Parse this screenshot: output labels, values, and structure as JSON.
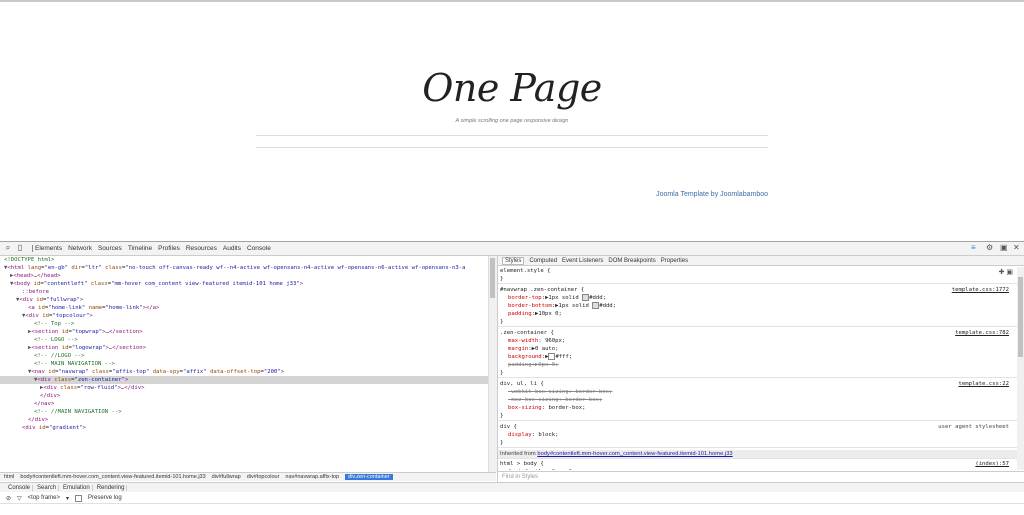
{
  "page": {
    "logo": "One Page",
    "tagline": "A simple scrolling one page responsive design",
    "footer_link": "Joomla Template by Joomlabamboo"
  },
  "devtools": {
    "tabs": [
      "Elements",
      "Network",
      "Sources",
      "Timeline",
      "Profiles",
      "Resources",
      "Audits",
      "Console"
    ],
    "dom_lines": [
      {
        "indent": 0,
        "html": "<span class='cmt'>&lt;!DOCTYPE html&gt;</span>"
      },
      {
        "indent": 0,
        "html": "<span class='tri'>▼</span><span class='tag'>&lt;html</span> <span class='attr'>lang</span>=<span class='val'>\"en-gb\"</span> <span class='attr'>dir</span>=<span class='val'>\"ltr\"</span> <span class='attr'>class</span>=<span class='val'>\"no-touch off-canvas-ready wf--n4-active wf-opensans-n4-active wf-opensans-n6-active wf-opensans-n3-a</span>"
      },
      {
        "indent": 1,
        "html": "<span class='tri'>▶</span><span class='tag'>&lt;head&gt;</span>…<span class='tag'>&lt;/head&gt;</span>"
      },
      {
        "indent": 1,
        "html": "<span class='tri'>▼</span><span class='tag'>&lt;body</span> <span class='attr'>id</span>=<span class='val'>\"contentleft\"</span> <span class='attr'>class</span>=<span class='val'>\"mm-hover com_content view-featured itemid-101 home j33\"</span><span class='tag'>&gt;</span>"
      },
      {
        "indent": 3,
        "html": "<span class='pseudo'>::before</span>"
      },
      {
        "indent": 2,
        "html": "<span class='tri'>▼</span><span class='tag'>&lt;div</span> <span class='attr'>id</span>=<span class='val'>\"fullwrap\"</span><span class='tag'>&gt;</span>"
      },
      {
        "indent": 4,
        "html": "<span class='tag'>&lt;a</span> <span class='attr'>id</span>=<span class='val'>\"home-link\"</span> <span class='attr'>name</span>=<span class='val'>\"home-link\"</span><span class='tag'>&gt;&lt;/a&gt;</span>"
      },
      {
        "indent": 3,
        "html": "<span class='tri'>▼</span><span class='tag'>&lt;div</span> <span class='attr'>id</span>=<span class='val'>\"topcolour\"</span><span class='tag'>&gt;</span>"
      },
      {
        "indent": 5,
        "html": "<span class='cmt'>&lt;!-- Top --&gt;</span>"
      },
      {
        "indent": 4,
        "html": "<span class='tri'>▶</span><span class='tag'>&lt;section</span> <span class='attr'>id</span>=<span class='val'>\"topwrap\"</span><span class='tag'>&gt;</span>…<span class='tag'>&lt;/section&gt;</span>"
      },
      {
        "indent": 5,
        "html": "<span class='cmt'>&lt;!-- LOGO --&gt;</span>"
      },
      {
        "indent": 4,
        "html": "<span class='tri'>▶</span><span class='tag'>&lt;section</span> <span class='attr'>id</span>=<span class='val'>\"logowrap\"</span><span class='tag'>&gt;</span>…<span class='tag'>&lt;/section&gt;</span>"
      },
      {
        "indent": 5,
        "html": "<span class='cmt'>&lt;!-- //LOGO --&gt;</span>"
      },
      {
        "indent": 5,
        "html": "<span class='cmt'>&lt;!-- MAIN NAVIGATION --&gt;</span>"
      },
      {
        "indent": 4,
        "html": "<span class='tri'>▼</span><span class='tag'>&lt;nav</span> <span class='attr'>id</span>=<span class='val'>\"navwrap\"</span> <span class='attr'>class</span>=<span class='val'>\"affix-top\"</span> <span class='attr'>data-spy</span>=<span class='val'>\"affix\"</span> <span class='attr'>data-offset-top</span>=<span class='val'>\"200\"</span><span class='tag'>&gt;</span>"
      },
      {
        "indent": 5,
        "sel": true,
        "html": "<span class='tri'>▼</span><span class='tag'>&lt;div</span> <span class='attr'>class</span>=<span class='val'>\"zen-container\"</span><span class='tag'>&gt;</span>"
      },
      {
        "indent": 6,
        "html": "<span class='tri'>▶</span><span class='tag'>&lt;div</span> <span class='attr'>class</span>=<span class='val'>\"row-fluid\"</span><span class='tag'>&gt;</span>…<span class='tag'>&lt;/div&gt;</span>"
      },
      {
        "indent": 6,
        "html": "<span class='tag'>&lt;/div&gt;</span>"
      },
      {
        "indent": 5,
        "html": "<span class='tag'>&lt;/nav&gt;</span>"
      },
      {
        "indent": 5,
        "html": "<span class='cmt'>&lt;!-- //MAIN NAVIGATION --&gt;</span>"
      },
      {
        "indent": 4,
        "html": "<span class='tag'>&lt;/div&gt;</span>"
      },
      {
        "indent": 3,
        "html": "<span class='tag'>&lt;div</span> <span class='attr'>id</span>=<span class='val'>\"gradient\"</span><span class='tag'>&gt;</span>"
      }
    ],
    "breadcrumbs": [
      "html",
      "body#contentleft.mm-hover.com_content.view-featured.itemid-101.home.j33",
      "div#fullwrap",
      "div#topcolour",
      "nav#navwrap.affix-top",
      "div.zen-container"
    ],
    "side_tabs": [
      "Styles",
      "Computed",
      "Event Listeners",
      "DOM Breakpoints",
      "Properties"
    ],
    "rules": [
      {
        "selector": "element.style {",
        "src": "",
        "lines": [
          "}"
        ]
      },
      {
        "selector": "#navwrap .zen-container {",
        "src": "template.css:1772",
        "props": [
          {
            "html": "<span class='pname'>border-top</span>:<span class='pval'>▶1px solid <span class='swatch'></span>#ddd;</span>"
          },
          {
            "html": "<span class='pname'>border-bottom</span>:<span class='pval'>▶1px solid <span class='swatch'></span>#ddd;</span>"
          },
          {
            "html": "<span class='pname'>padding</span>:<span class='pval'>▶10px 0;</span>"
          }
        ]
      },
      {
        "selector": ".zen-container {",
        "src": "template.css:782",
        "props": [
          {
            "html": "<span class='pname'>max-width</span>: <span class='pval'>960px;</span>"
          },
          {
            "html": "<span class='pname'>margin</span>:<span class='pval'>▶0 auto;</span>"
          },
          {
            "html": "<span class='pname'>background</span>:<span class='pval'>▶<span class='swatch white'></span>#fff;</span>"
          },
          {
            "html": "<span class='strike'>padding:▶0px 0;</span>"
          }
        ]
      },
      {
        "selector": "div, ul, li {",
        "src": "template.css:22",
        "props": [
          {
            "html": "<span class='strike'>-webkit-box-sizing: border-box;</span>"
          },
          {
            "html": "<span class='strike'>-moz-box-sizing: border-box;</span>"
          },
          {
            "html": "<span class='pname'>box-sizing</span>: <span class='pval'>border-box;</span>"
          }
        ]
      },
      {
        "selector": "div {",
        "src": "user agent stylesheet",
        "plain": true,
        "props": [
          {
            "html": "<span class='pname'>display</span>: <span class='pval'>block;</span>"
          }
        ]
      }
    ],
    "inherited_label": "Inherited from",
    "inherited_link": "body#contentleft.mm-hover.com_content.view-featured.itemid-101.home.j33",
    "html_body_rule": "html > body {",
    "html_body_src": "(index):57",
    "font_family_partial": "font-family: Open Sans;",
    "find_placeholder": "Find in Styles",
    "drawer_tabs": [
      "Console",
      "Search",
      "Emulation",
      "Rendering"
    ],
    "frame_select": "<top frame>",
    "preserve_log": "Preserve log"
  }
}
